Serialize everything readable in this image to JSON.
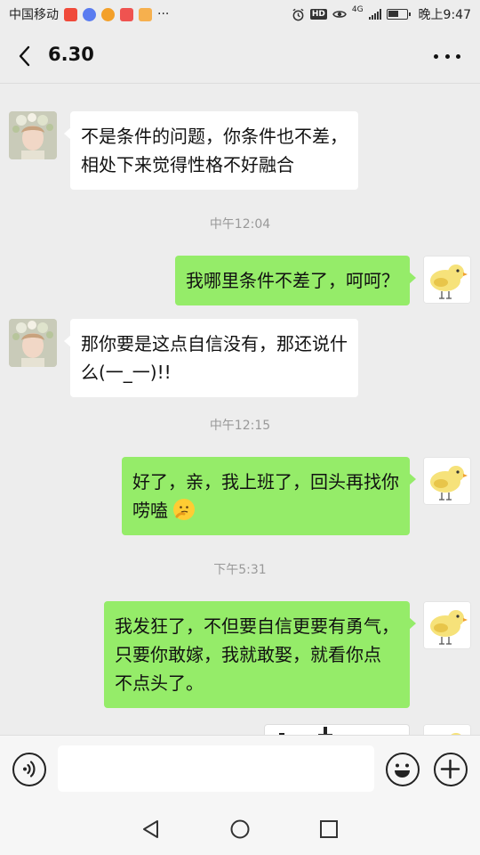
{
  "status_bar": {
    "carrier": "中国移动",
    "time": "晚上9:47",
    "hd_label": "HD",
    "network_label": "4G",
    "overflow": "···",
    "app_icons": [
      "#f04a3a",
      "#5a7cf0",
      "#f3a02a",
      "#ef5350",
      "#f6b04e"
    ]
  },
  "header": {
    "title": "6.30",
    "back_icon": "chevron-left-icon",
    "more_icon": "more-horizontal-icon"
  },
  "messages": [
    {
      "side": "left",
      "text_lines": [
        "不是条件的问题，你条件也不差，",
        "相处下来觉得性格不好融合"
      ]
    },
    {
      "time": "中午12:04"
    },
    {
      "side": "right",
      "text_lines": [
        "我哪里条件不差了，呵呵？"
      ]
    },
    {
      "side": "left",
      "text_lines": [
        "那你要是这点自信没有，那还说什",
        "么(一_一)!!"
      ]
    },
    {
      "time": "中午12:15"
    },
    {
      "side": "right",
      "text_lines": [
        "好了，亲，我上班了，回头再找你",
        "唠嗑"
      ],
      "trailing_emoji": "thinking-face-emoji"
    },
    {
      "time": "下午5:31"
    },
    {
      "side": "right",
      "text_lines": [
        "我发狂了，不但要自信更要有勇气，",
        "只要你敢嫁，我就敢娶，就看你点",
        "不点头了。"
      ]
    }
  ],
  "input_bar": {
    "voice_icon": "voice-icon",
    "text_value": "",
    "emoji_icon": "emoji-icon",
    "plus_icon": "plus-icon"
  },
  "nav_bar": {
    "icons": [
      "nav-back-icon",
      "nav-home-icon",
      "nav-recent-icon"
    ]
  },
  "colors": {
    "background": "#ededed",
    "bubble_sent": "#95ec69",
    "bubble_received": "#ffffff",
    "timestamp": "#999999"
  }
}
